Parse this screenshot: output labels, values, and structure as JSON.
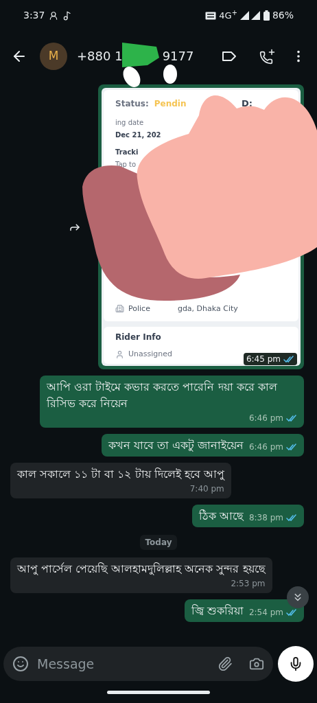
{
  "status_bar": {
    "time": "3:37",
    "network": "4G$^{+}$",
    "battery": "86%"
  },
  "header": {
    "avatar": "M",
    "number_start": "+880 1",
    "number_end": "9177"
  },
  "messages": [
    {
      "kind": "card",
      "outgoing": true,
      "time": "6:45 pm",
      "read": true,
      "card": {
        "status_label": "Status:",
        "status_value": "Pendin",
        "right_fragment": "D:",
        "date_label": "ing date",
        "date_value": "Dec 21, 202",
        "tracking_label": "Tracki",
        "tracking_hint": "Tap to",
        "address_start": "Police",
        "address_end": "gda, Dhaka City",
        "rider_title": "Rider Info",
        "rider_value": "Unassigned"
      }
    },
    {
      "kind": "text",
      "outgoing": true,
      "text": "আপি ওরা টাইমে কভার করতে পারেনি দয়া করে কাল রিসিভ করে নিয়েন",
      "time": "6:46 pm",
      "read": true
    },
    {
      "kind": "text",
      "outgoing": true,
      "text": "কখন যাবে তা একটু জানাইয়েন",
      "time": "6:46 pm",
      "read": true
    },
    {
      "kind": "text",
      "outgoing": false,
      "text": "কাল সকালে ১১ টা বা ১২ টায় দিলেই হবে  আপু",
      "time": "7:40 pm"
    },
    {
      "kind": "text",
      "outgoing": true,
      "text": "ঠিক আছে",
      "time": "8:38 pm",
      "read": true
    },
    {
      "kind": "date",
      "text": "Today"
    },
    {
      "kind": "text",
      "outgoing": false,
      "text": "আপু পার্সেল পেয়েছি আলহামদুলিল্লাহ অনেক সুন্দর হয়ছে",
      "time": "2:53 pm"
    },
    {
      "kind": "text",
      "outgoing": true,
      "text": "জ্বি শুকরিয়া",
      "time": "2:54 pm",
      "read": true
    }
  ],
  "composer": {
    "placeholder": "Message"
  }
}
